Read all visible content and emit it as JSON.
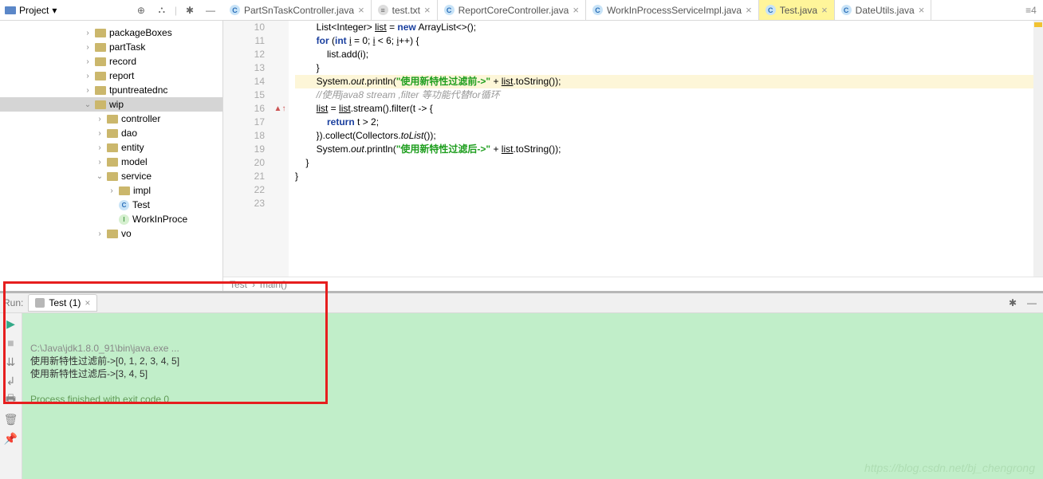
{
  "header": {
    "project_label": "Project",
    "tabs": [
      {
        "label": "PartSnTaskController.java",
        "icon": "java",
        "active": false
      },
      {
        "label": "test.txt",
        "icon": "txt",
        "active": false
      },
      {
        "label": "ReportCoreController.java",
        "icon": "java",
        "active": false
      },
      {
        "label": "WorkInProcessServiceImpl.java",
        "icon": "java",
        "active": false
      },
      {
        "label": "Test.java",
        "icon": "java",
        "active": true
      },
      {
        "label": "DateUtils.java",
        "icon": "java",
        "active": false
      }
    ],
    "right_badge": "≡4"
  },
  "tree": [
    {
      "indent": 7,
      "chev": "›",
      "icon": "pkg",
      "label": "packageBoxes"
    },
    {
      "indent": 7,
      "chev": "›",
      "icon": "pkg",
      "label": "partTask"
    },
    {
      "indent": 7,
      "chev": "›",
      "icon": "pkg",
      "label": "record"
    },
    {
      "indent": 7,
      "chev": "›",
      "icon": "pkg",
      "label": "report"
    },
    {
      "indent": 7,
      "chev": "›",
      "icon": "pkg",
      "label": "tpuntreatednc"
    },
    {
      "indent": 7,
      "chev": "⌄",
      "icon": "pkg",
      "label": "wip",
      "selected": true
    },
    {
      "indent": 8,
      "chev": "›",
      "icon": "pkg",
      "label": "controller"
    },
    {
      "indent": 8,
      "chev": "›",
      "icon": "pkg",
      "label": "dao"
    },
    {
      "indent": 8,
      "chev": "›",
      "icon": "pkg",
      "label": "entity"
    },
    {
      "indent": 8,
      "chev": "›",
      "icon": "pkg",
      "label": "model"
    },
    {
      "indent": 8,
      "chev": "⌄",
      "icon": "pkg",
      "label": "service"
    },
    {
      "indent": 9,
      "chev": "›",
      "icon": "pkg",
      "label": "impl"
    },
    {
      "indent": 9,
      "chev": "",
      "icon": "class",
      "glyph": "C",
      "label": "Test"
    },
    {
      "indent": 9,
      "chev": "",
      "icon": "iface",
      "glyph": "I",
      "label": "WorkInProce"
    },
    {
      "indent": 8,
      "chev": "›",
      "icon": "pkg",
      "label": "vo"
    }
  ],
  "editor": {
    "first_line": 10,
    "lines": [
      {
        "n": 10,
        "html": "        List&lt;Integer&gt; <span class='ul'>list</span> = <span class='kw'>new</span> ArrayList&lt;&gt;();"
      },
      {
        "n": 11,
        "html": "        <span class='kw'>for</span> (<span class='kw'>int</span> <span class='ul'>i</span> = 0; <span class='ul'>i</span> &lt; 6; <span class='ul'>i</span>++) {"
      },
      {
        "n": 12,
        "html": "            list.add(i);"
      },
      {
        "n": 13,
        "html": "        }"
      },
      {
        "n": 14,
        "hl": true,
        "html": "        System.<span class='it'>out</span>.println(<span class='st'>\"使用新特性过滤前-&gt;\"</span> + <span class='ul'>list</span>.toString());"
      },
      {
        "n": 15,
        "html": "        <span class='cm'>//使用java8 stream ,filter 等功能代替for循环</span>"
      },
      {
        "n": 16,
        "mark": "▲↑",
        "html": "        <span class='ul'>list</span> = <span class='ul'>list</span>.stream().filter(t -&gt; {"
      },
      {
        "n": 17,
        "html": "            <span class='kw'>return</span> t &gt; 2;"
      },
      {
        "n": 18,
        "html": "        }).collect(Collectors.<span class='it'>toList</span>());"
      },
      {
        "n": 19,
        "html": "        System.<span class='it'>out</span>.println(<span class='st'>\"使用新特性过滤后-&gt;\"</span> + <span class='ul'>list</span>.toString());"
      },
      {
        "n": 20,
        "html": "    }"
      },
      {
        "n": 21,
        "html": "}"
      },
      {
        "n": 22,
        "html": ""
      },
      {
        "n": 23,
        "html": ""
      }
    ],
    "breadcrumb": [
      "Test",
      "main()"
    ]
  },
  "run": {
    "panel_label": "Run:",
    "tab_label": "Test (1)",
    "output": [
      {
        "cls": "grey",
        "text": "C:\\Java\\jdk1.8.0_91\\bin\\java.exe ..."
      },
      {
        "cls": "",
        "text": "使用新特性过滤前->[0, 1, 2, 3, 4, 5]"
      },
      {
        "cls": "",
        "text": "使用新特性过滤后->[3, 4, 5]"
      },
      {
        "cls": "",
        "text": ""
      },
      {
        "cls": "ok",
        "text": "Process finished with exit code 0"
      }
    ],
    "watermark": "https://blog.csdn.net/bj_chengrong"
  }
}
